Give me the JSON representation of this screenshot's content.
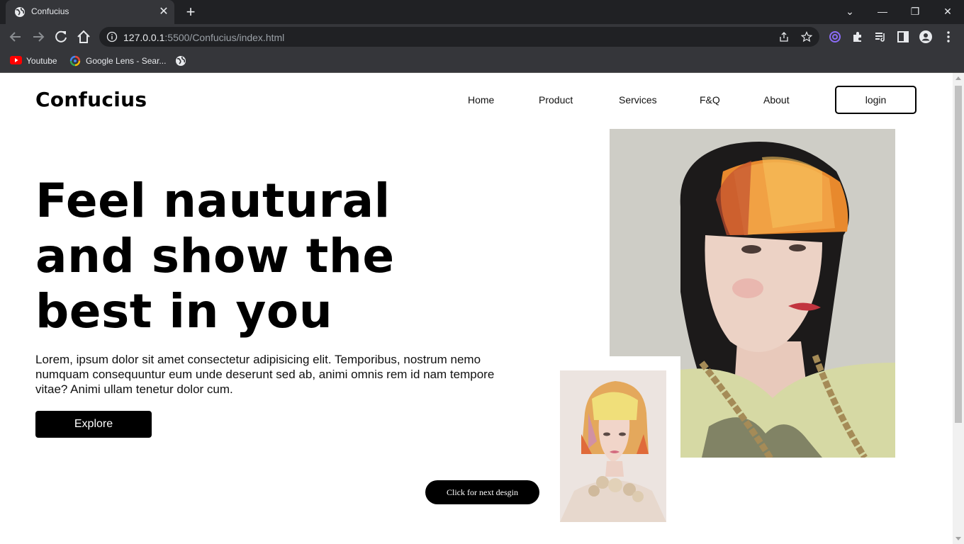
{
  "browser": {
    "tab_title": "Confucius",
    "url_host": "127.0.0.1",
    "url_path": ":5500/Confucius/index.html",
    "bookmarks": [
      {
        "label": "Youtube"
      },
      {
        "label": "Google Lens - Sear..."
      }
    ]
  },
  "site": {
    "logo": "Confucius",
    "nav": [
      "Home",
      "Product",
      "Services",
      "F&Q",
      "About"
    ],
    "login_label": "login"
  },
  "hero": {
    "title_line1": "Feel nautural",
    "title_line2": "and show the",
    "title_line3": "best in you",
    "paragraph": "Lorem, ipsum dolor sit amet consectetur adipisicing elit. Temporibus, nostrum nemo numquam consequuntur eum unde deserunt sed ab, animi omnis rem id nam tempore vitae? Animi ullam tenetur dolor cum.",
    "explore_label": "Explore",
    "next_label": "Click for next desgin"
  },
  "colors": {
    "accent": "#000000",
    "background": "#ffffff",
    "chrome_dark": "#202124",
    "chrome_mid": "#35363a"
  },
  "icons": [
    "globe-icon",
    "close-icon",
    "plus-icon",
    "back-icon",
    "forward-icon",
    "reload-icon",
    "home-icon",
    "info-icon",
    "share-icon",
    "star-icon",
    "extension-icon",
    "profile-icon",
    "menu-icon"
  ]
}
